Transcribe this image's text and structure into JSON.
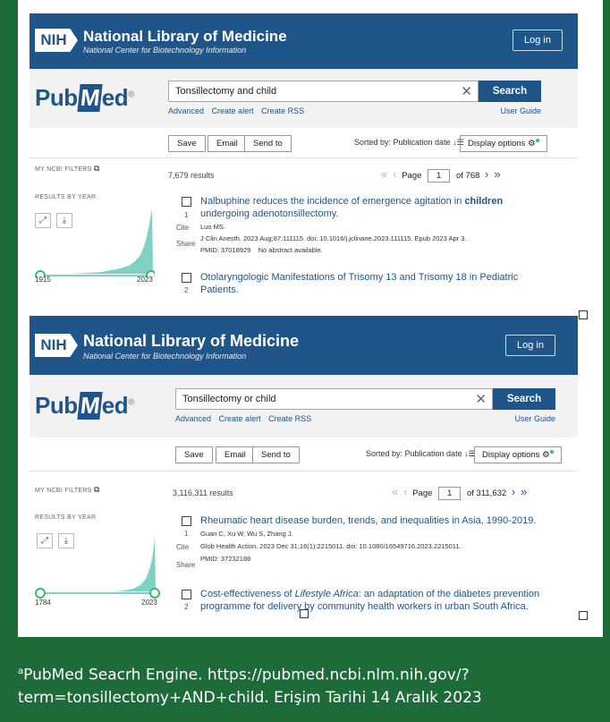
{
  "panels": [
    {
      "nih": {
        "title": "National Library of Medicine",
        "subtitle": "National Center for Biotechnology Information",
        "login": "Log in",
        "badge": "NIH"
      },
      "logo": {
        "pub": "Pub",
        "m": "M",
        "ed": "ed",
        "reg": "®"
      },
      "search": {
        "query": "Tonsillectomy and child",
        "clear": "✕",
        "button": "Search",
        "links": [
          "Advanced",
          "Create alert",
          "Create RSS"
        ],
        "guide": "User Guide"
      },
      "toolbar": {
        "save": "Save",
        "email": "Email",
        "send": "Send to",
        "sorted": "Sorted by: Publication date",
        "display": "Display options"
      },
      "filters": {
        "my_ncbi": "MY NCBI FILTERS",
        "by_year": "RESULTS BY YEAR",
        "year_start": "1915",
        "year_end": "2023"
      },
      "chart_data": {
        "type": "area",
        "x_range": [
          "1915",
          "2023"
        ],
        "trend": "low-flat-then-sharp-rise-near-recent-years"
      },
      "results_count": "7,679 results",
      "pager": {
        "page_label": "Page",
        "page": "1",
        "of": "of 768"
      },
      "results": [
        {
          "num": "1",
          "title_pre": "Nalbuphine reduces the incidence of emergence agitation in ",
          "title_bold": "children",
          "title_post": " undergoing adenotonsillectomy.",
          "authors": "Luo MS.",
          "journal": "J Clin Anesth. 2023 Aug;87:111115. doi: 10.1016/j.jclinane.2023.111115. Epub 2023 Apr 3.",
          "pmid": "PMID: 37018929",
          "note": "No abstract available.",
          "cite": "Cite",
          "share": "Share"
        },
        {
          "num": "2",
          "title_pre": "Otolaryngologic Manifestations of Trisomy 13 and Trisomy 18 in Pediatric Patients.",
          "title_bold": "",
          "title_post": ""
        }
      ]
    },
    {
      "nih": {
        "title": "National Library of Medicine",
        "subtitle": "National Center for Biotechnology Information",
        "login": "Log in",
        "badge": "NIH"
      },
      "logo": {
        "pub": "Pub",
        "m": "M",
        "ed": "ed",
        "reg": "®"
      },
      "search": {
        "query": "Tonsillectomy or child",
        "clear": "✕",
        "button": "Search",
        "links": [
          "Advanced",
          "Create alert",
          "Create RSS"
        ],
        "guide": "User Guide"
      },
      "toolbar": {
        "save": "Save",
        "email": "Email",
        "send": "Send to",
        "sorted": "Sorted by: Publication date",
        "display": "Display options"
      },
      "filters": {
        "my_ncbi": "MY NCBI FILTERS",
        "by_year": "RESULTS BY YEAR",
        "year_start": "1784",
        "year_end": "2023"
      },
      "results_count": "3,116,311 results",
      "pager": {
        "page_label": "Page",
        "page": "1",
        "of": "of 311,632"
      },
      "results": [
        {
          "num": "1",
          "title_pre": "Rheumatic heart disease burden, trends, and inequalities in Asia, 1990-2019.",
          "authors": "Guan C, Xu W, Wu S, Zhang J.",
          "journal": "Glob Health Action. 2023 Dec 31;16(1):2215011. doi: 10.1080/16549716.2023.2215011.",
          "pmid": "PMID: 37232188",
          "cite": "Cite",
          "share": "Share"
        },
        {
          "num": "2",
          "title_a": "Cost-effectiveness of ",
          "title_i": "Lifestyle Africa",
          "title_b": ": an adaptation of the diabetes prevention programme for delivery by community health workers in urban South Africa."
        }
      ]
    }
  ],
  "caption": {
    "sup": "a",
    "text": "PubMed Seacrh Engine. https://pubmed.ncbi.nlm.nih.gov/?term=tonsillectomy+AND+child. Erişim Tarihi 14 Aralık 2023"
  },
  "colors": {
    "frame_green": "#1e6b3a",
    "nih_blue": "#20558a",
    "chart_teal": "#7fd1c3"
  }
}
